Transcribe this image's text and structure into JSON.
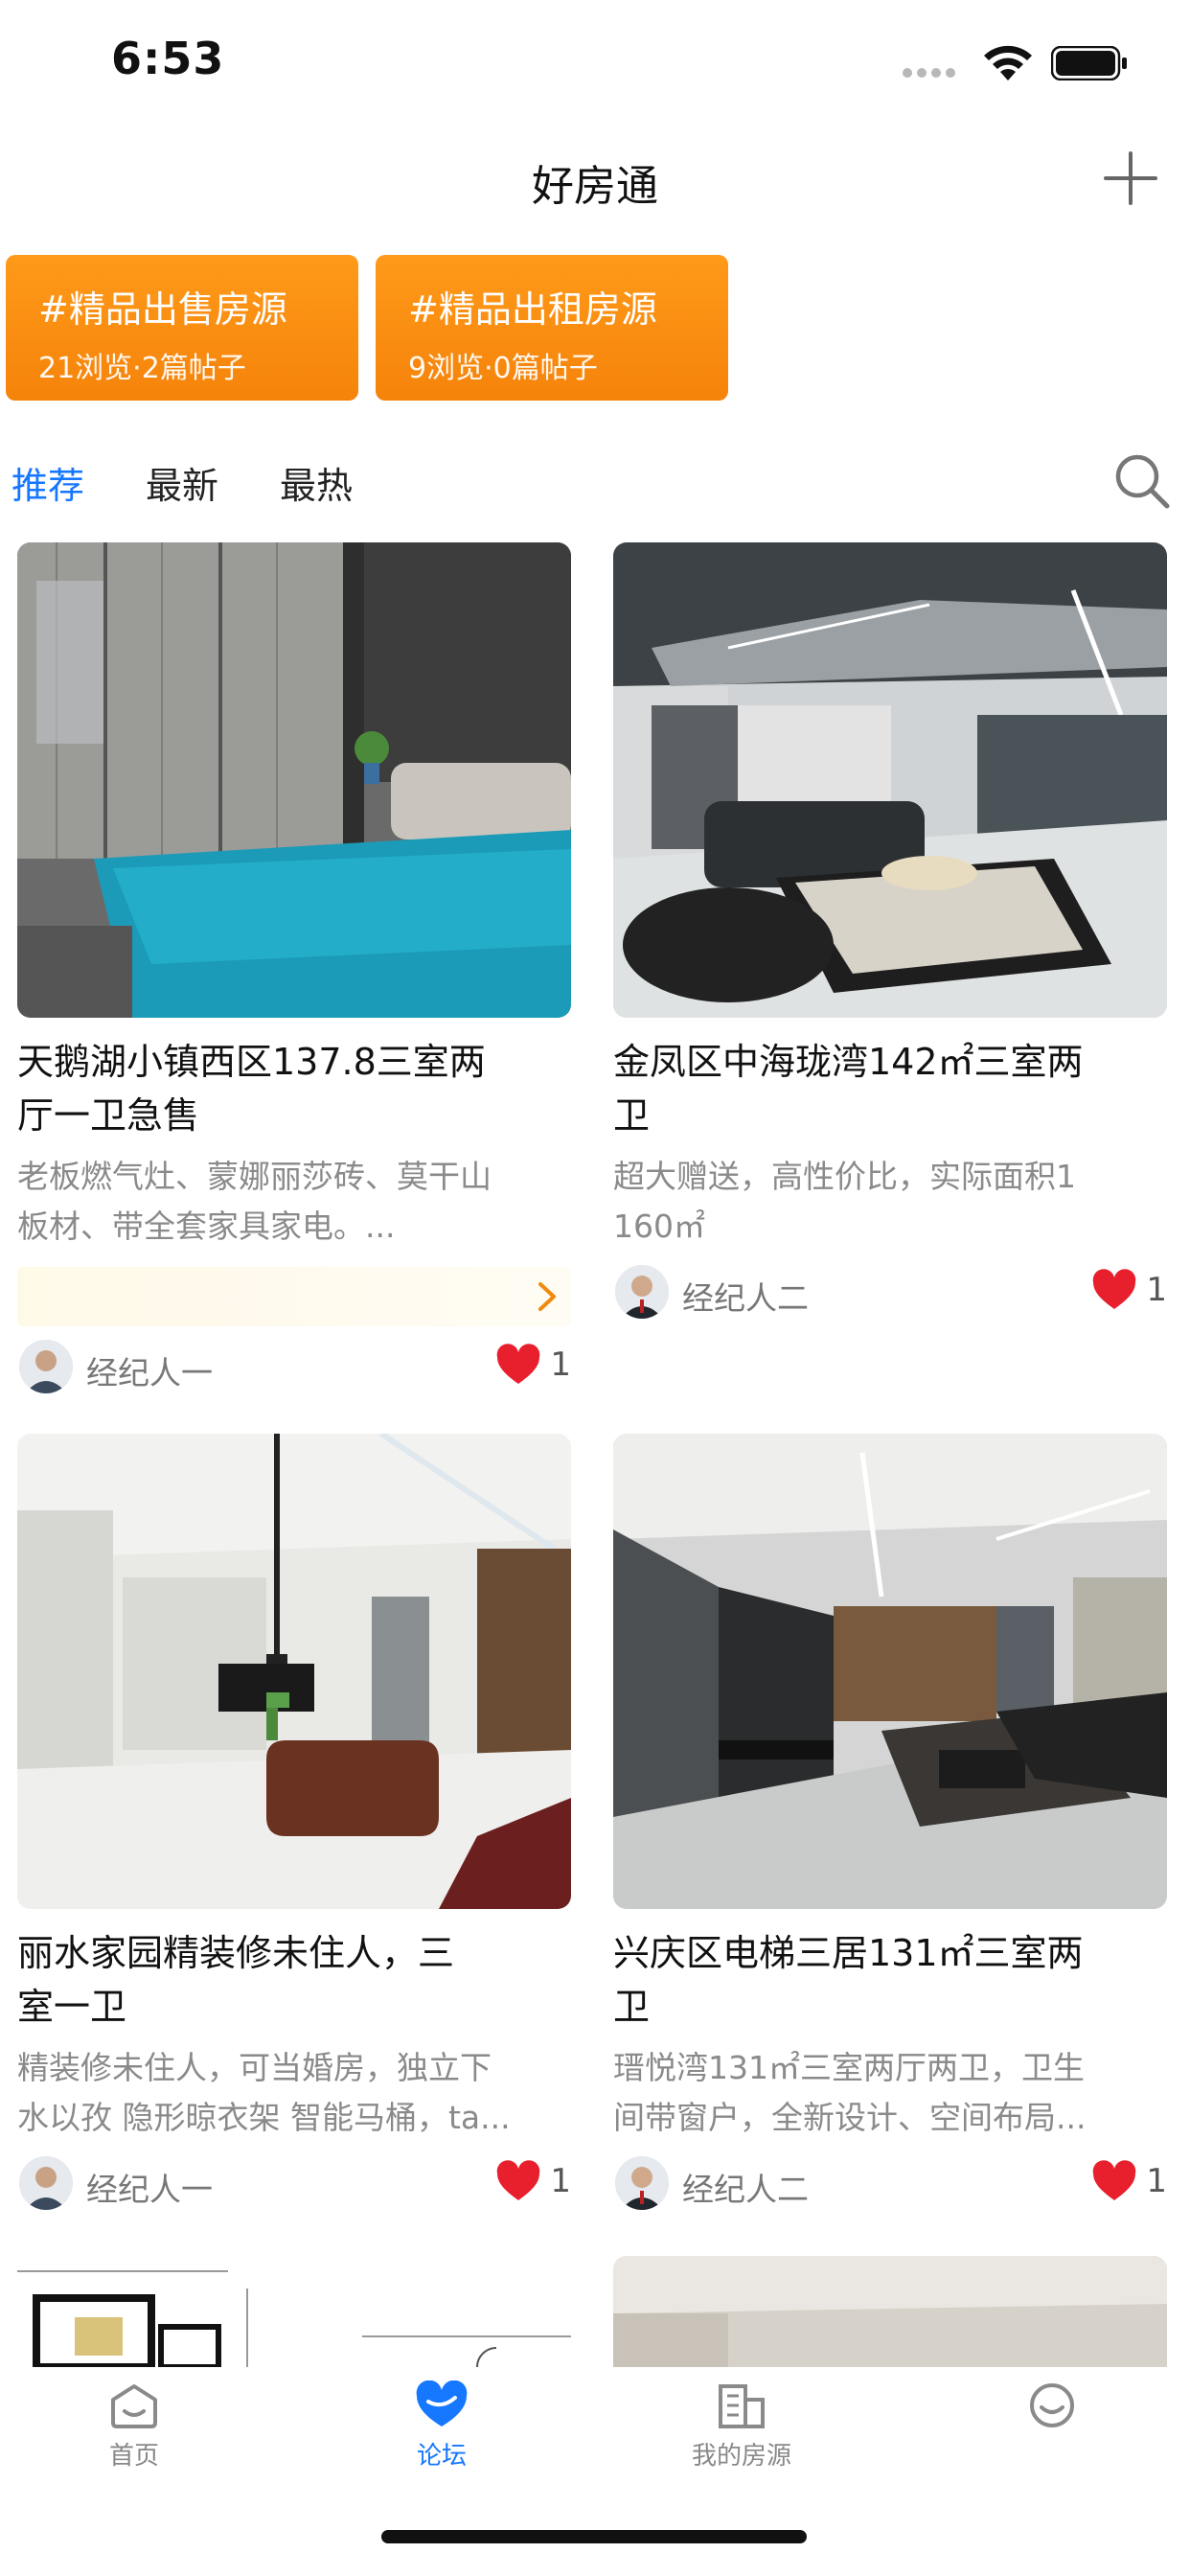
{
  "status_bar": {
    "time": "6:53"
  },
  "nav": {
    "title": "好房通"
  },
  "topics": [
    {
      "title": "#精品出售房源",
      "stats": "21浏览·2篇帖子"
    },
    {
      "title": "#精品出租房源",
      "stats": "9浏览·0篇帖子"
    }
  ],
  "tabs": [
    {
      "label": "推荐",
      "active": true
    },
    {
      "label": "最新",
      "active": false
    },
    {
      "label": "最热",
      "active": false
    }
  ],
  "posts": [
    {
      "title_lines": [
        "天鹅湖小镇西区137.8三室两",
        "厅一卫急售"
      ],
      "desc_lines": [
        "老板燃气灶、蒙娜丽莎砖、莫干山",
        "板材、带全套家具家电。..."
      ],
      "author": "经纪人一",
      "likes": "1"
    },
    {
      "title_lines": [
        "金凤区中海珑湾142㎡三室两",
        "卫"
      ],
      "desc_lines": [
        "超大赠送，高性价比，实际面积1",
        "160㎡"
      ],
      "author": "经纪人二",
      "likes": "1"
    },
    {
      "title_lines": [
        "丽水家园精装修未住人，三",
        "室一卫"
      ],
      "desc_lines": [
        "精装修未住人，可当婚房，独立下",
        "水以孜 隐形晾衣架 智能马桶，ta..."
      ],
      "author": "经纪人一",
      "likes": "1"
    },
    {
      "title_lines": [
        "兴庆区电梯三居131㎡三室两",
        "卫"
      ],
      "desc_lines": [
        "瑨悦湾131㎡三室两厅两卫，卫生",
        "间带窗户，全新设计、空间布局..."
      ],
      "author": "经纪人二",
      "likes": "1"
    }
  ],
  "tab_bar": [
    {
      "label": "首页",
      "icon": "home-icon",
      "active": false
    },
    {
      "label": "论坛",
      "icon": "forum-heart-icon",
      "active": true
    },
    {
      "label": "我的房源",
      "icon": "building-icon",
      "active": false
    },
    {
      "label": "",
      "icon": "profile-smile-icon",
      "active": false
    }
  ],
  "colors": {
    "accent": "#1677ff",
    "chip": "#f5830a",
    "heart": "#e8202e"
  }
}
